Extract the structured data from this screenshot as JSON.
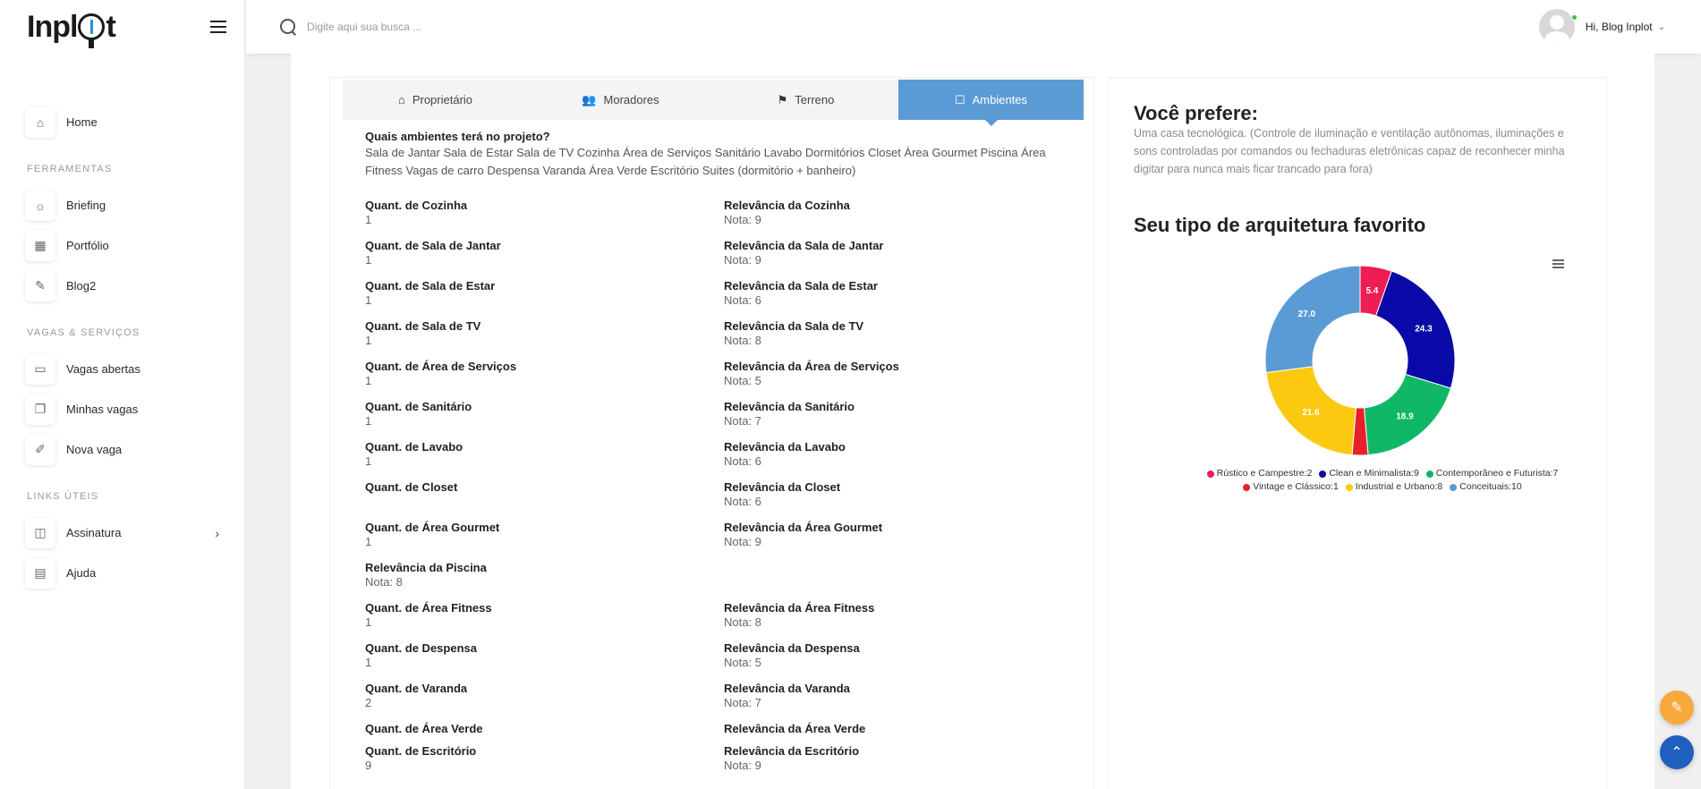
{
  "brand": {
    "logo_pre": "Inpl",
    "logo_post": "t"
  },
  "sidebar": {
    "home": "Home",
    "sections": [
      "FERRAMENTAS",
      "VAGAS & SERVIÇOS",
      "LINKS ÚTEIS"
    ],
    "ferramentas": [
      "Briefing",
      "Portfólio",
      "Blog2"
    ],
    "vagas": [
      "Vagas abertas",
      "Minhas vagas",
      "Nova vaga"
    ],
    "links": [
      "Assinatura",
      "Ajuda"
    ]
  },
  "topbar": {
    "search_placeholder": "Digite aqui sua busca ...",
    "greeting": "Hi,",
    "user_name": "Blog Inplot"
  },
  "tabs": [
    {
      "label": "Proprietário",
      "icon": "home-icon",
      "glyph": "⌂"
    },
    {
      "label": "Moradores",
      "icon": "users-icon",
      "glyph": "👥"
    },
    {
      "label": "Terreno",
      "icon": "flag-icon",
      "glyph": "⚑"
    },
    {
      "label": "Ambientes",
      "icon": "square-icon",
      "glyph": "☐",
      "active": true
    }
  ],
  "question": {
    "label": "Quais ambientes terá no projeto?",
    "value": "Sala de Jantar Sala de Estar Sala de TV Cozinha Área de Serviços Sanitário Lavabo Dormitórios Closet Área Gourmet Piscina Área Fitness Vagas de carro Despensa Varanda Área Verde Escritório Suites (dormitório + banheiro)"
  },
  "fields": [
    {
      "q_label": "Quant. de Cozinha",
      "q_value": "1",
      "r_label": "Relevância da Cozinha",
      "r_value": "Nota: 9"
    },
    {
      "q_label": "Quant. de Sala de Jantar",
      "q_value": "1",
      "r_label": "Relevância da Sala de Jantar",
      "r_value": "Nota: 9"
    },
    {
      "q_label": "Quant. de Sala de Estar",
      "q_value": "1",
      "r_label": "Relevância da Sala de Estar",
      "r_value": "Nota: 6"
    },
    {
      "q_label": "Quant. de Sala de TV",
      "q_value": "1",
      "r_label": "Relevância da Sala de TV",
      "r_value": "Nota: 8"
    },
    {
      "q_label": "Quant. de Área de Serviços",
      "q_value": "1",
      "r_label": "Relevância da Área de Serviços",
      "r_value": "Nota: 5"
    },
    {
      "q_label": "Quant. de Sanitário",
      "q_value": "1",
      "r_label": "Relevância da Sanitário",
      "r_value": "Nota: 7"
    },
    {
      "q_label": "Quant. de Lavabo",
      "q_value": "1",
      "r_label": "Relevância da Lavabo",
      "r_value": "Nota: 6"
    },
    {
      "q_label": "Quant. de Closet",
      "q_value": "",
      "r_label": "Relevância da Closet",
      "r_value": "Nota: 6"
    },
    {
      "q_label": "Quant. de Área Gourmet",
      "q_value": "1",
      "r_label": "Relevância da Área Gourmet",
      "r_value": "Nota: 9"
    },
    {
      "q_label": "Relevância da Piscina",
      "q_value": "Nota: 8",
      "r_label": "",
      "r_value": ""
    },
    {
      "q_label": "Quant. de Área Fitness",
      "q_value": "1",
      "r_label": "Relevância da Área Fitness",
      "r_value": "Nota: 8"
    },
    {
      "q_label": "Quant. de Despensa",
      "q_value": "1",
      "r_label": "Relevância da Despensa",
      "r_value": "Nota: 5"
    },
    {
      "q_label": "Quant. de Varanda",
      "q_value": "2",
      "r_label": "Relevância da Varanda",
      "r_value": "Nota: 7"
    },
    {
      "q_label": "Quant. de Área Verde",
      "q_value": "",
      "r_label": "Relevância da Área Verde",
      "r_value": ""
    },
    {
      "q_label": "Quant. de Escritório",
      "q_value": "9",
      "r_label": "Relevância da Escritório",
      "r_value": "Nota: 9"
    }
  ],
  "preference": {
    "title": "Você prefere:",
    "text": "Uma casa tecnológica. (Controle de iluminação e ventilação autônomas, iluminações e sons controladas por comandos ou fechaduras eletrônicas capaz de reconhecer minha digitar para nunca mais ficar trancado para fora)"
  },
  "architecture": {
    "title": "Seu tipo de arquitetura favorito"
  },
  "chart_data": {
    "type": "pie",
    "variant": "donut",
    "categories": [
      "Rústico e Campestre",
      "Clean e Minimalista",
      "Contemporâneo e Futurista",
      "Vintage e Clássico",
      "Industrial e Urbano",
      "Conceituais"
    ],
    "counts": [
      2,
      9,
      7,
      1,
      8,
      10
    ],
    "values": [
      5.4,
      24.3,
      18.9,
      2.7,
      21.6,
      27.0
    ],
    "slice_labels": [
      "5.4",
      "24.3",
      "18.9",
      "",
      "21.6",
      "27.0"
    ],
    "legend_labels": [
      "Rústico e Campestre:2",
      "Clean e Minimalista:9",
      "Contemporâneo e Futurista:7",
      "Vintage e Clássico:1",
      "Industrial e Urbano:8",
      "Conceituais:10"
    ],
    "colors": [
      "#ee1d54",
      "#0a0aa8",
      "#10b866",
      "#e8202a",
      "#fbca10",
      "#5b9bd5"
    ],
    "legend_position": "bottom"
  }
}
